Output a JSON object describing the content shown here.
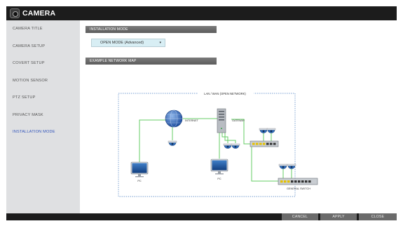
{
  "window": {
    "title": "CAMERA"
  },
  "sidebar": {
    "items": [
      {
        "label": "CAMERA TITLE"
      },
      {
        "label": "CAMERA SETUP"
      },
      {
        "label": "COVERT SETUP"
      },
      {
        "label": "MOTION SENSOR"
      },
      {
        "label": "PTZ SETUP"
      },
      {
        "label": "PRIVACY MASK"
      },
      {
        "label": "INSTALLATION MODE",
        "active": true
      }
    ]
  },
  "main": {
    "installation_mode": {
      "header": "INSTALLATION MODE",
      "selected": "OPEN MODE (Advanced)",
      "arrow": "▾"
    },
    "network_map": {
      "header": "EXAMPLE NETWORK MAP",
      "lan_wan_label": "LAN / WAN  (OPEN NETWORK)",
      "internet_label": "INTERNET",
      "gateway_label": "GATEWAY",
      "pc_label": "PC",
      "switch_label": "GENERAL SWITCH"
    }
  },
  "footer": {
    "cancel": "CANCEL",
    "apply": "APPLY",
    "close": "CLOSE"
  },
  "colors": {
    "link_line": "#66cc66",
    "dashed_border": "#4a7fc1",
    "active_item": "#3355bb",
    "title_bar": "#1c1c1c",
    "sidebar": "#dfe0e2"
  }
}
